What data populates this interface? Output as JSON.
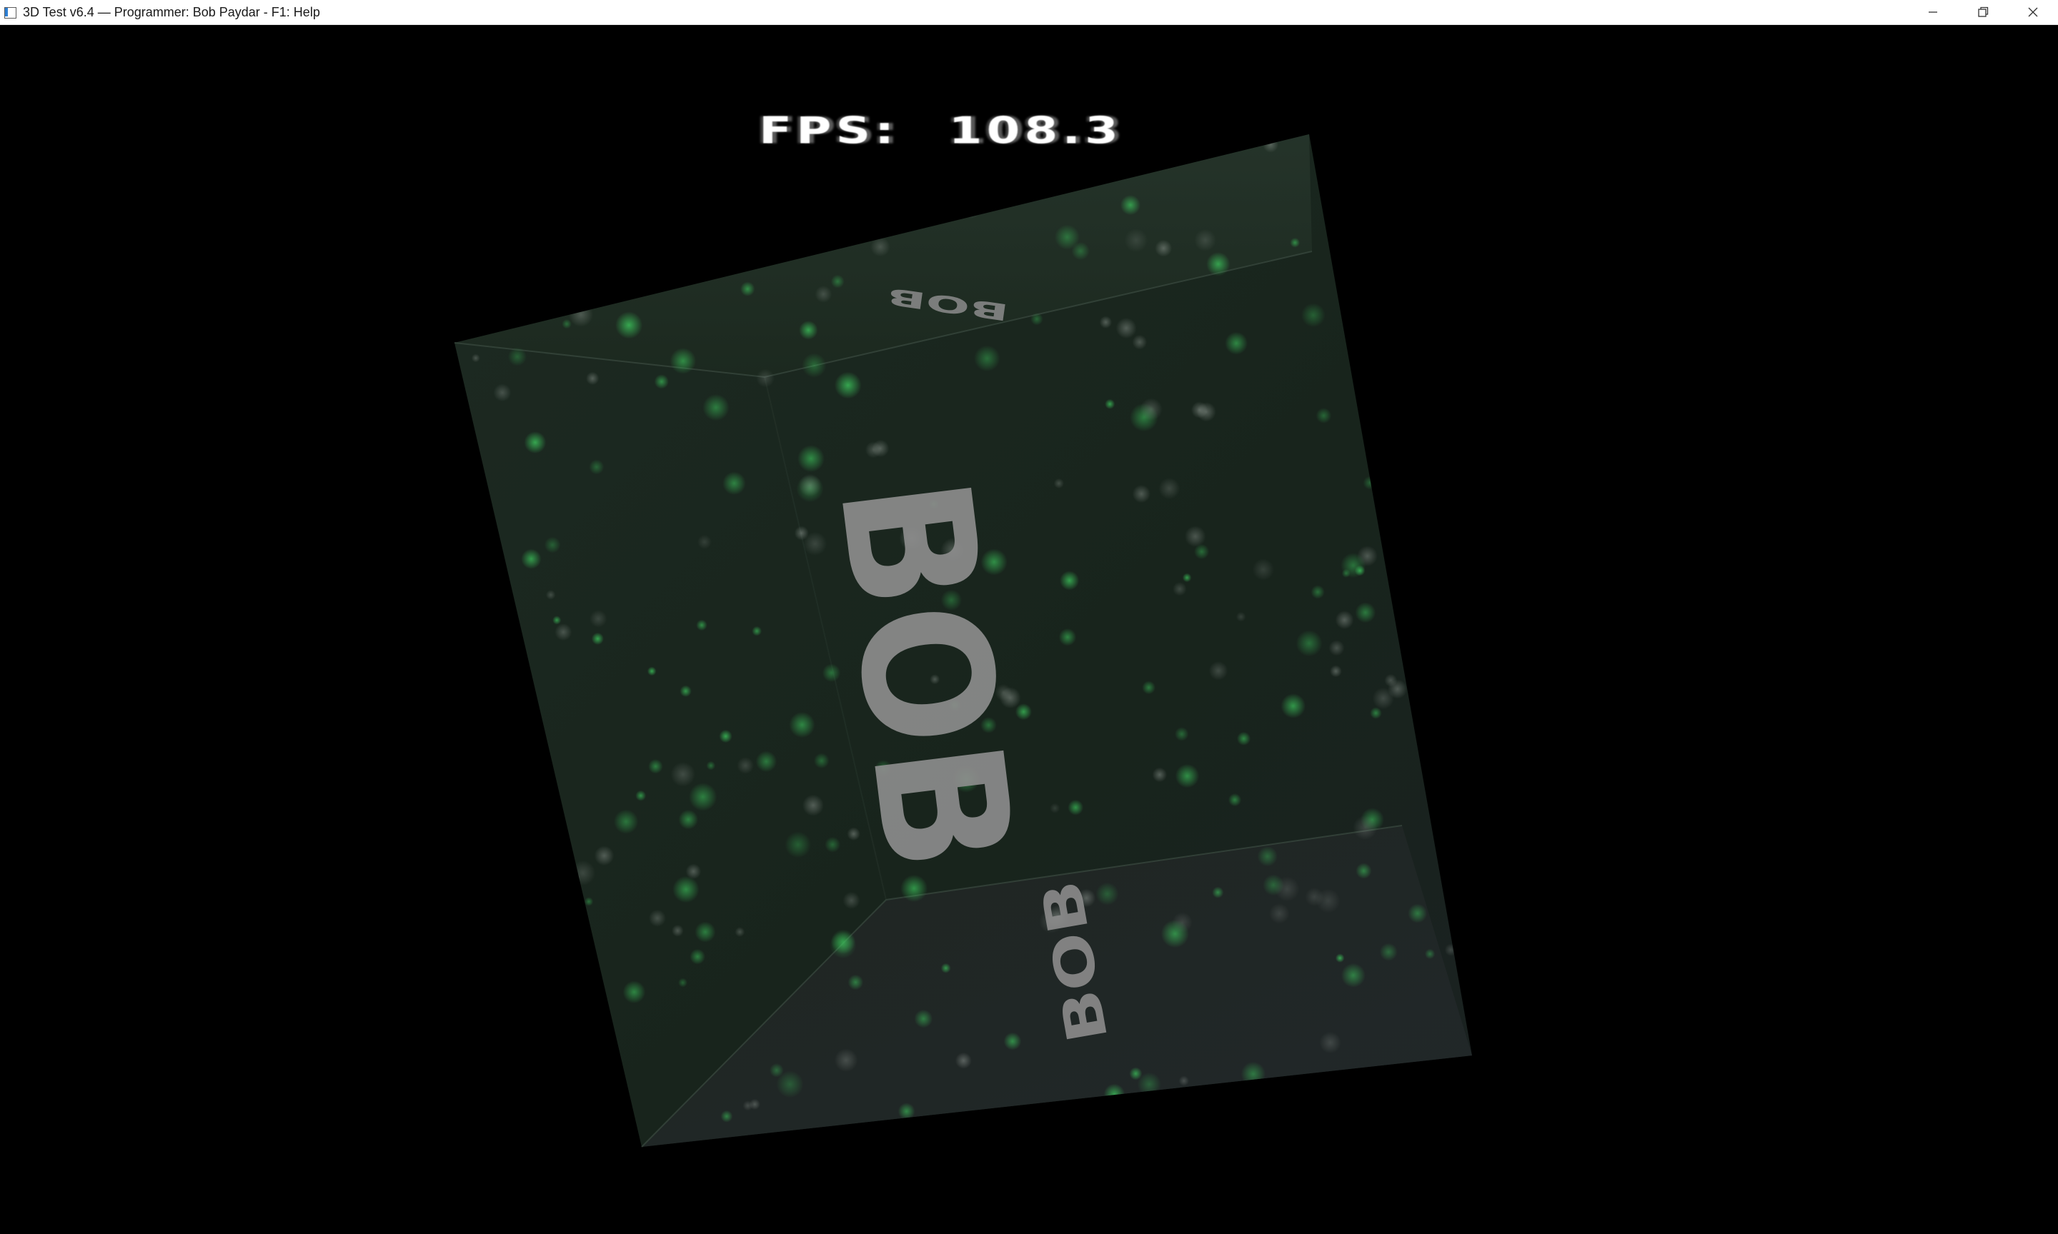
{
  "window": {
    "title": "3D Test v6.4 — Programmer: Bob Paydar - F1: Help",
    "controls": {
      "minimize_icon": "minimize-icon",
      "restore_icon": "restore-icon",
      "close_icon": "close-icon"
    }
  },
  "hud": {
    "fps_label": "FPS:",
    "fps_value": "108.3"
  },
  "scene": {
    "face_text": "BOB",
    "top_face_text": "BOB",
    "bottom_face_text": "BOB",
    "colors": {
      "background": "#000000",
      "cube_face": "#1c2820",
      "text": "#8c8c8c",
      "particles": "#2fbf4a"
    }
  }
}
